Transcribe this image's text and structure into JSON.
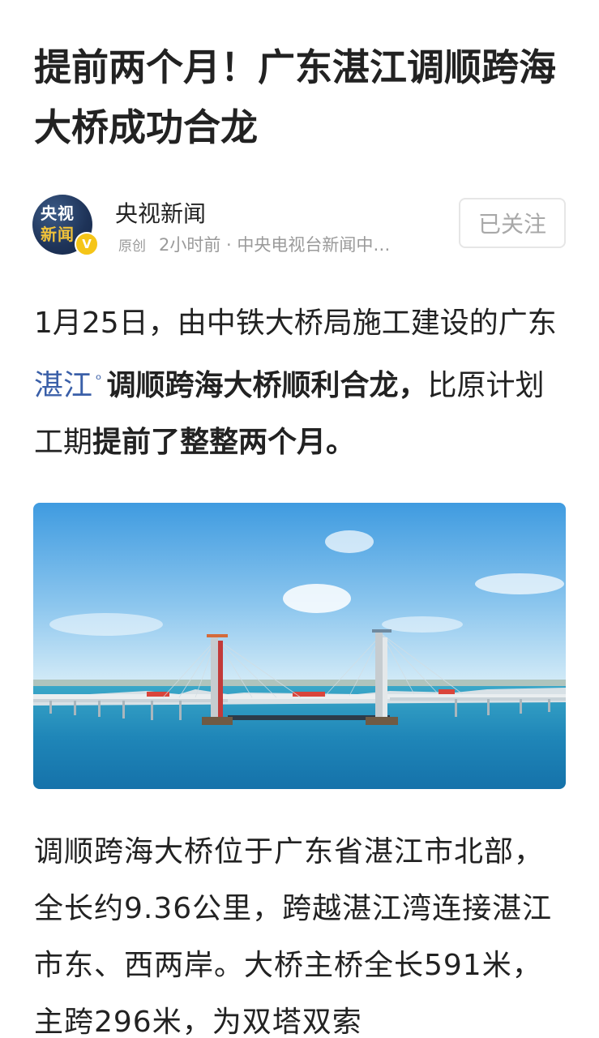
{
  "article": {
    "title": "提前两个月！广东湛江调顺跨海大桥成功合龙",
    "author": {
      "avatar_line1": "央视",
      "avatar_line2": "新闻",
      "verified_mark": "V",
      "name": "央视新闻",
      "original_tag": "原创",
      "meta": "2小时前 · 中央电视台新闻中…"
    },
    "follow_label": "已关注",
    "paragraph1": {
      "part1": "1月25日，由中铁大桥局施工建设的广东",
      "link": "湛江",
      "part2": "调顺跨海大桥顺利合龙，",
      "part3": "比原计划工期",
      "part4": "提前了整整两个月。"
    },
    "paragraph2": "调顺跨海大桥位于广东省湛江市北部，全长约9.36公里，跨越湛江湾连接湛江市东、西两岸。大桥主桥全长591米，主跨296米，为双塔双索"
  },
  "icons": {
    "link_icon": "location-pin-icon",
    "verified_icon": "verified-v-icon"
  },
  "colors": {
    "link": "#3a5fa8",
    "verified": "#f5c518",
    "meta_text": "#9a9a9a"
  }
}
